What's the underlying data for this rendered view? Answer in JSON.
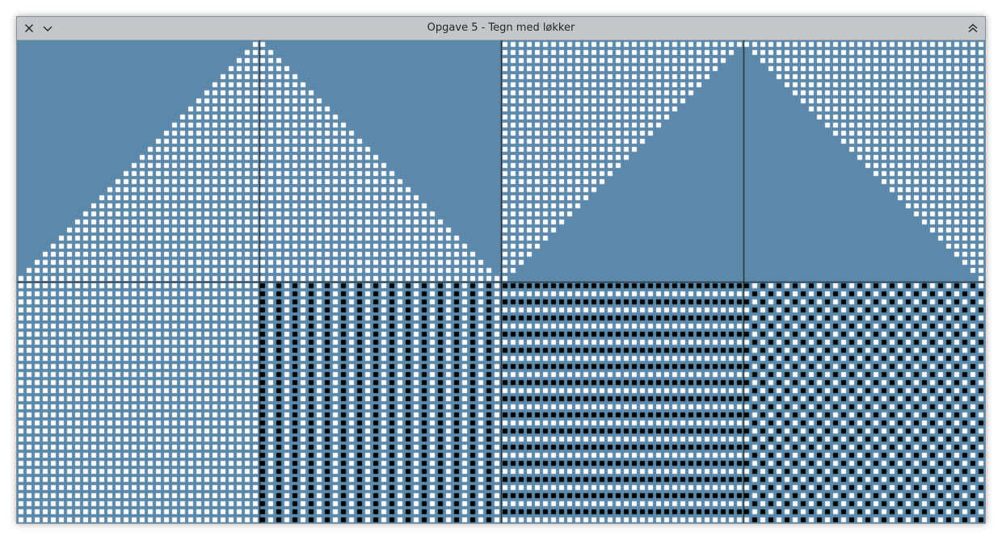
{
  "window": {
    "title": "Opgave 5 - Tegn med løkker",
    "buttons": {
      "close_icon": "close-icon",
      "minimize_icon": "chevron-down-icon",
      "maximize_icon": "chevron-double-up-icon"
    }
  },
  "drawing": {
    "background_color": "#5c89aa",
    "dot_white": "#ffffff",
    "dot_black": "#000000",
    "divider_color": "#1a1a1a",
    "grid_cols": 4,
    "grid_rows": 2,
    "dots_per_panel": 30,
    "panels": [
      {
        "row": 0,
        "col": 0,
        "pattern": "triangle-lower-right"
      },
      {
        "row": 0,
        "col": 1,
        "pattern": "triangle-lower-left"
      },
      {
        "row": 0,
        "col": 2,
        "pattern": "triangle-upper-left"
      },
      {
        "row": 0,
        "col": 3,
        "pattern": "triangle-upper-right"
      },
      {
        "row": 1,
        "col": 0,
        "pattern": "all-white"
      },
      {
        "row": 1,
        "col": 1,
        "pattern": "vertical-stripes"
      },
      {
        "row": 1,
        "col": 2,
        "pattern": "horizontal-stripes"
      },
      {
        "row": 1,
        "col": 3,
        "pattern": "checker"
      }
    ]
  }
}
